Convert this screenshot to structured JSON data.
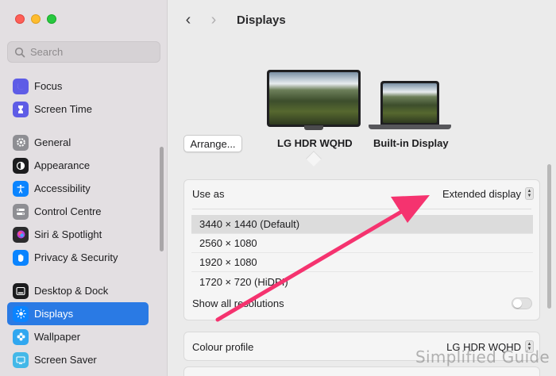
{
  "sidebar": {
    "search_placeholder": "Search",
    "items": [
      {
        "label": "Focus",
        "icon": "moon-icon",
        "color": "#5e5ce6"
      },
      {
        "label": "Screen Time",
        "icon": "hourglass-icon",
        "color": "#5e5ce6"
      },
      {
        "label": "General",
        "icon": "gear-icon",
        "color": "#8e8e93"
      },
      {
        "label": "Appearance",
        "icon": "appearance-icon",
        "color": "#1c1c1e"
      },
      {
        "label": "Accessibility",
        "icon": "accessibility-icon",
        "color": "#0a84ff"
      },
      {
        "label": "Control Centre",
        "icon": "control-centre-icon",
        "color": "#8e8e93"
      },
      {
        "label": "Siri & Spotlight",
        "icon": "siri-icon",
        "color": "#2b2b2d"
      },
      {
        "label": "Privacy & Security",
        "icon": "hand-icon",
        "color": "#0a84ff"
      },
      {
        "label": "Desktop & Dock",
        "icon": "dock-icon",
        "color": "#1c1c1e"
      },
      {
        "label": "Displays",
        "icon": "sun-icon",
        "color": "#0a84ff"
      },
      {
        "label": "Wallpaper",
        "icon": "flower-icon",
        "color": "#30a7f0"
      },
      {
        "label": "Screen Saver",
        "icon": "screen-saver-icon",
        "color": "#43b8e8"
      }
    ]
  },
  "header": {
    "title": "Displays",
    "back": "‹",
    "forward": "›"
  },
  "arrange_label": "Arrange...",
  "displays": {
    "primary": "LG HDR WQHD",
    "builtin": "Built-in Display"
  },
  "settings": {
    "use_as_label": "Use as",
    "use_as_value": "Extended display",
    "resolutions": [
      "3440 × 1440 (Default)",
      "2560 × 1080",
      "1920 × 1080",
      "1720 × 720 (HiDPI)"
    ],
    "show_all_label": "Show all resolutions",
    "colour_profile_label": "Colour profile",
    "colour_profile_value": "LG HDR WQHD"
  },
  "watermark": "Simplified Guide",
  "colors": {
    "accent": "#2a7ae4",
    "annotation_arrow": "#f5336f"
  }
}
